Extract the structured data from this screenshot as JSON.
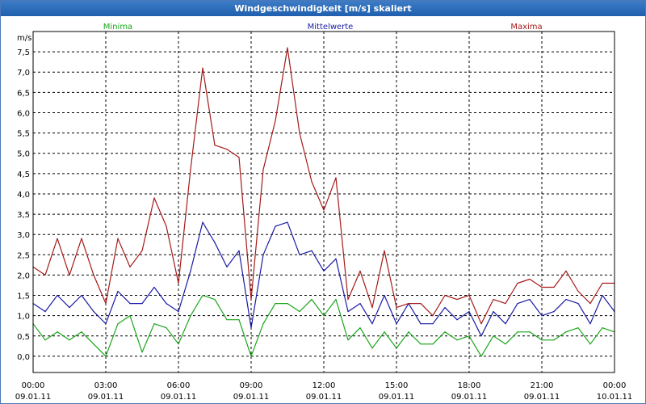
{
  "window": {
    "title": "Windgeschwindigkeit [m/s] skaliert"
  },
  "colors": {
    "minima": "#1aa51a",
    "mittelwerte": "#1a1aa6",
    "maxima": "#a61a1a",
    "titlebar": "#2b6cb8"
  },
  "chart_data": {
    "type": "line",
    "title": "Windgeschwindigkeit [m/s] skaliert",
    "ylabel": "m/s",
    "ylim": [
      -0.4,
      8.0
    ],
    "xlim": [
      0,
      24
    ],
    "grid": true,
    "legend_placement": "top",
    "y_ticks": [
      "0,0",
      "0,5",
      "1,0",
      "1,5",
      "2,0",
      "2,5",
      "3,0",
      "3,5",
      "4,0",
      "4,5",
      "5,0",
      "5,5",
      "6,0",
      "6,5",
      "7,0",
      "7,5"
    ],
    "x_ticks": [
      {
        "time": "00:00",
        "date": "09.01.11"
      },
      {
        "time": "03:00",
        "date": "09.01.11"
      },
      {
        "time": "06:00",
        "date": "09.01.11"
      },
      {
        "time": "09:00",
        "date": "09.01.11"
      },
      {
        "time": "12:00",
        "date": "09.01.11"
      },
      {
        "time": "15:00",
        "date": "09.01.11"
      },
      {
        "time": "18:00",
        "date": "09.01.11"
      },
      {
        "time": "21:00",
        "date": "09.01.11"
      },
      {
        "time": "00:00",
        "date": "10.01.11"
      }
    ],
    "x_hours": [
      0,
      0.5,
      1,
      1.5,
      2,
      2.5,
      3,
      3.5,
      4,
      4.5,
      5,
      5.5,
      6,
      6.5,
      7,
      7.5,
      8,
      8.5,
      9,
      9.5,
      10,
      10.5,
      11,
      11.5,
      12,
      12.5,
      13,
      13.5,
      14,
      14.5,
      15,
      15.5,
      16,
      16.5,
      17,
      17.5,
      18,
      18.5,
      19,
      19.5,
      20,
      20.5,
      21,
      21.5,
      22,
      22.5,
      23,
      23.5,
      24
    ],
    "series": [
      {
        "name": "Minima",
        "color": "#1aa51a",
        "values": [
          0.8,
          0.4,
          0.6,
          0.4,
          0.6,
          0.3,
          0.0,
          0.8,
          1.0,
          0.1,
          0.8,
          0.7,
          0.3,
          1.0,
          1.5,
          1.4,
          0.9,
          0.9,
          0.0,
          0.8,
          1.3,
          1.3,
          1.1,
          1.4,
          1.0,
          1.4,
          0.4,
          0.7,
          0.2,
          0.6,
          0.2,
          0.6,
          0.3,
          0.3,
          0.6,
          0.4,
          0.5,
          0.0,
          0.5,
          0.3,
          0.6,
          0.6,
          0.4,
          0.4,
          0.6,
          0.7,
          0.3,
          0.7,
          0.6
        ]
      },
      {
        "name": "Mittelwerte",
        "color": "#1a1aa6",
        "values": [
          1.3,
          1.1,
          1.5,
          1.2,
          1.5,
          1.1,
          0.8,
          1.6,
          1.3,
          1.3,
          1.7,
          1.3,
          1.1,
          2.1,
          3.3,
          2.8,
          2.2,
          2.6,
          0.7,
          2.5,
          3.2,
          3.3,
          2.5,
          2.6,
          2.1,
          2.4,
          1.1,
          1.3,
          0.8,
          1.5,
          0.8,
          1.3,
          0.8,
          0.8,
          1.2,
          0.9,
          1.1,
          0.5,
          1.1,
          0.8,
          1.3,
          1.4,
          1.0,
          1.1,
          1.4,
          1.3,
          0.8,
          1.5,
          1.1
        ]
      },
      {
        "name": "Maxima",
        "color": "#a61a1a",
        "values": [
          2.2,
          2.0,
          2.9,
          2.0,
          2.9,
          2.0,
          1.3,
          2.9,
          2.2,
          2.6,
          3.9,
          3.2,
          1.8,
          4.6,
          7.1,
          5.2,
          5.1,
          4.9,
          1.4,
          4.6,
          5.8,
          7.6,
          5.5,
          4.3,
          3.6,
          4.4,
          1.4,
          2.1,
          1.2,
          2.6,
          1.2,
          1.3,
          1.3,
          1.0,
          1.5,
          1.4,
          1.5,
          0.8,
          1.4,
          1.3,
          1.8,
          1.9,
          1.7,
          1.7,
          2.1,
          1.6,
          1.3,
          1.8,
          1.8
        ]
      }
    ]
  }
}
